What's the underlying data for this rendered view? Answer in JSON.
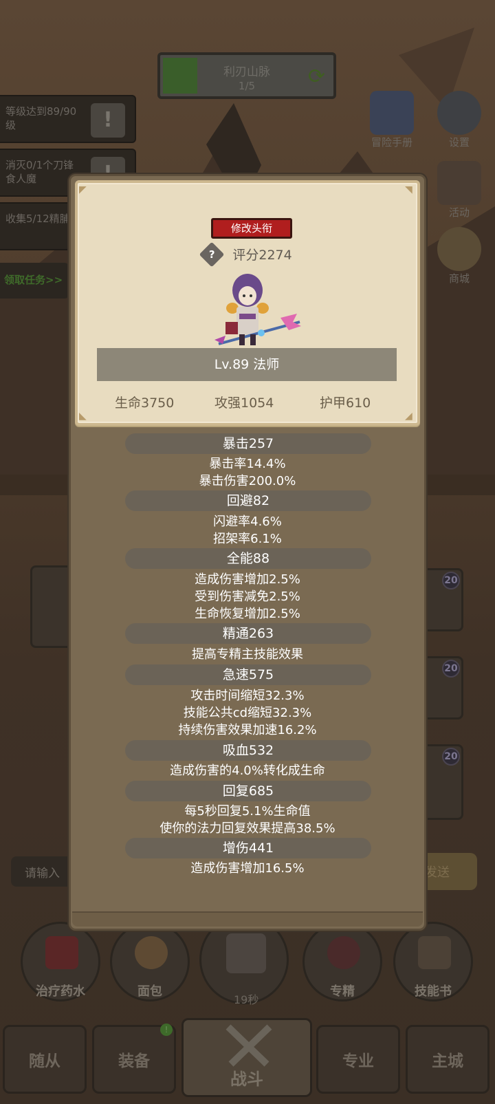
{
  "zone": {
    "name": "利刃山脉",
    "progress_text": "1/5",
    "progress_fraction": 0.2
  },
  "quests": [
    {
      "text": "等级达到89/90级",
      "icon": "exclamation-icon"
    },
    {
      "text": "消灭0/1个刀锋食人魔",
      "icon": "exclamation-icon"
    },
    {
      "text": "收集5/12精脯",
      "icon": "exclamation-icon"
    }
  ],
  "quest_link": "领取任务>>",
  "side_buttons": {
    "adventure_handbook": "冒险手册",
    "settings": "设置",
    "activity": "活动",
    "shop": "商城"
  },
  "slot_badges": [
    "20",
    "20",
    "20"
  ],
  "chat": {
    "placeholder": "请输入",
    "send_label": "发送"
  },
  "quick_items": [
    {
      "label": "治疗药水",
      "icon": "potion-icon"
    },
    {
      "label": "面包",
      "icon": "bread-icon"
    },
    {
      "label": "专精",
      "icon": "specialization-icon"
    },
    {
      "label": "技能书",
      "icon": "skill-book-icon"
    }
  ],
  "chest_timer": "19秒",
  "nav": {
    "followers": "随从",
    "equipment": "装备",
    "battle": "战斗",
    "profession": "专业",
    "main_city": "主城",
    "equipment_badge": "!"
  },
  "profile": {
    "edit_title_button": "修改头衔",
    "score": "评分2274",
    "level_class": "Lv.89 法师",
    "health": "生命3750",
    "attack_power": "攻强1054",
    "armor": "护甲610"
  },
  "attributes": [
    {
      "header": "暴击257",
      "lines": [
        "暴击率14.4%",
        "暴击伤害200.0%"
      ]
    },
    {
      "header": "回避82",
      "lines": [
        "闪避率4.6%",
        "招架率6.1%"
      ]
    },
    {
      "header": "全能88",
      "lines": [
        "造成伤害增加2.5%",
        "受到伤害减免2.5%",
        "生命恢复增加2.5%"
      ]
    },
    {
      "header": "精通263",
      "lines": [
        "提高专精主技能效果"
      ]
    },
    {
      "header": "急速575",
      "lines": [
        "攻击时间缩短32.3%",
        "技能公共cd缩短32.3%",
        "持续伤害效果加速16.2%"
      ]
    },
    {
      "header": "吸血532",
      "lines": [
        "造成伤害的4.0%转化成生命"
      ]
    },
    {
      "header": "回复685",
      "lines": [
        "每5秒回复5.1%生命值",
        "使你的法力回复效果提高38.5%"
      ]
    },
    {
      "header": "增伤441",
      "lines": [
        "造成伤害增加16.5%"
      ]
    }
  ]
}
